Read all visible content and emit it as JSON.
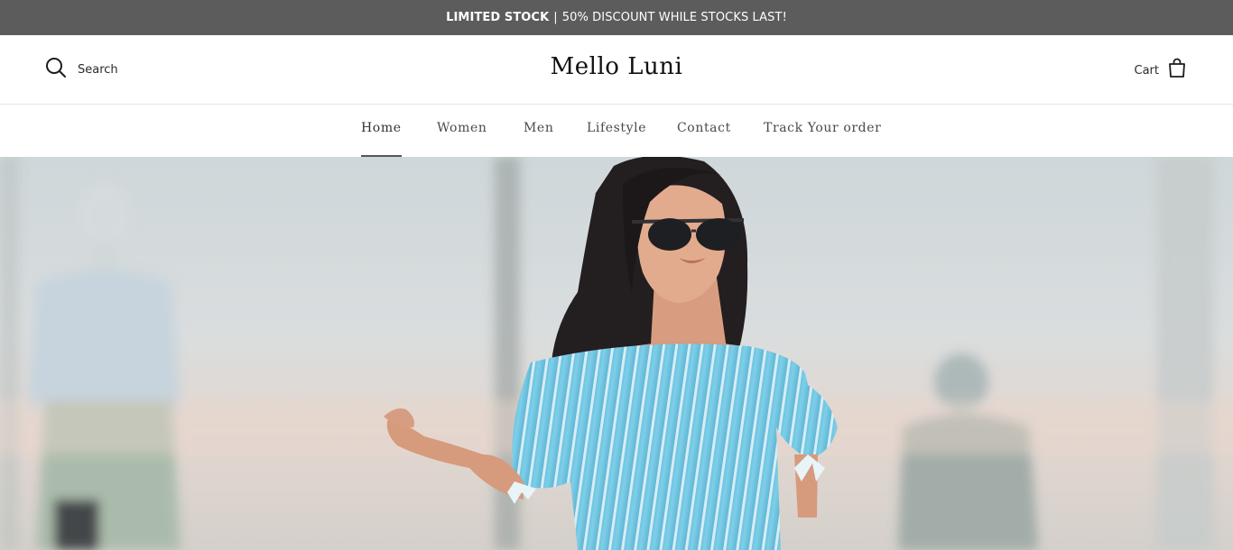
{
  "announcement": {
    "bold_text": "LIMITED STOCK",
    "separator": "|",
    "text": "50% DISCOUNT WHILE STOCKS LAST!"
  },
  "header": {
    "search_label": "Search",
    "search_icon": "search-icon",
    "logo": "Mello Luni",
    "cart_label": "Cart",
    "cart_icon": "shopping-bag-icon"
  },
  "nav": {
    "items": [
      {
        "label": "Home",
        "active": true
      },
      {
        "label": "Women",
        "active": false
      },
      {
        "label": "Men",
        "active": false
      },
      {
        "label": "Lifestyle",
        "active": false
      },
      {
        "label": "Contact",
        "active": false
      },
      {
        "label": "Track Your order",
        "active": false
      }
    ]
  },
  "colors": {
    "announcement_bg": "#5c5c5c",
    "announcement_text": "#ffffff",
    "header_bg": "#ffffff",
    "nav_text": "#4a4a4a",
    "active_underline": "#555555",
    "dress_blue": "#6cc4e0"
  }
}
